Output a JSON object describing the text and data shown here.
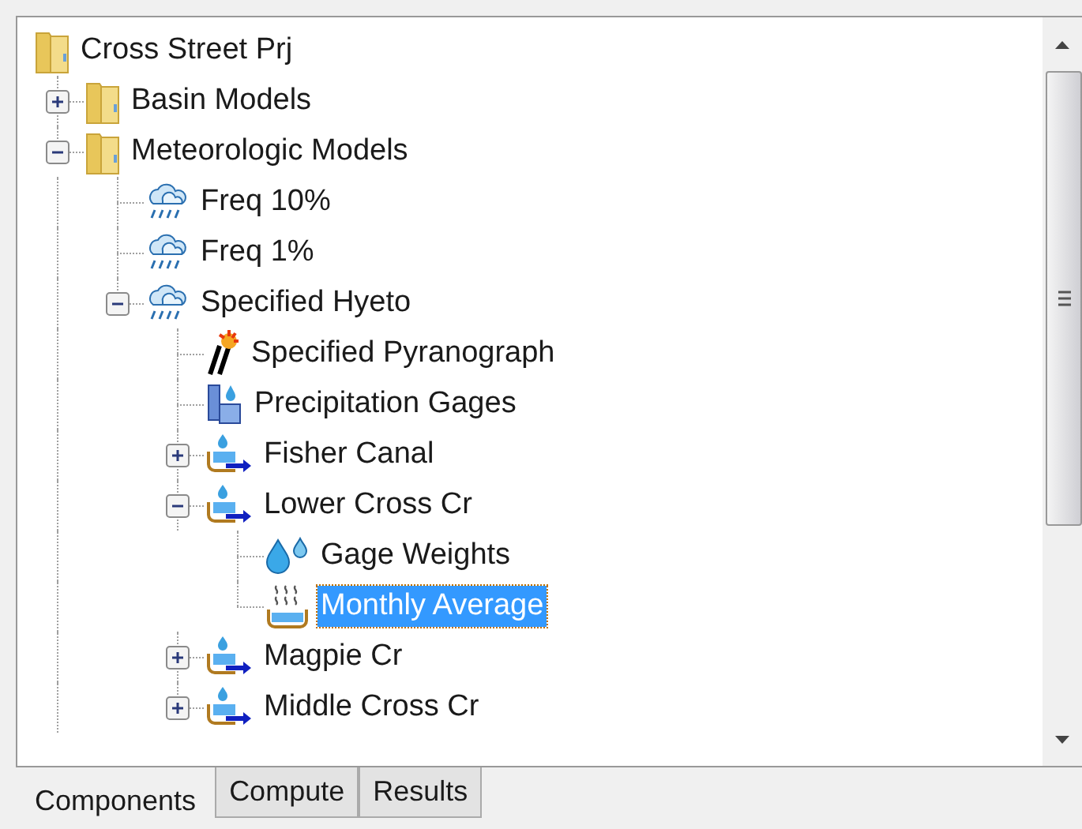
{
  "tree": {
    "label": "Cross Street Prj",
    "kind": "folder",
    "children": [
      {
        "label": "Basin Models",
        "kind": "folder",
        "expanded": false,
        "selected": false
      },
      {
        "label": "Meteorologic Models",
        "kind": "folder",
        "expanded": true,
        "selected": false,
        "children": [
          {
            "label": "Freq 10%",
            "kind": "meteo",
            "selected": false
          },
          {
            "label": "Freq 1%",
            "kind": "meteo",
            "selected": false
          },
          {
            "label": "Specified Hyeto",
            "kind": "meteo",
            "expanded": true,
            "selected": false,
            "children": [
              {
                "label": "Specified Pyranograph",
                "kind": "pyranograph",
                "selected": false
              },
              {
                "label": "Precipitation Gages",
                "kind": "gages",
                "selected": false
              },
              {
                "label": "Fisher Canal",
                "kind": "subbasin",
                "expanded": false,
                "selected": false
              },
              {
                "label": "Lower Cross Cr",
                "kind": "subbasin",
                "expanded": true,
                "selected": false,
                "children": [
                  {
                    "label": "Gage Weights",
                    "kind": "weights",
                    "selected": false
                  },
                  {
                    "label": "Monthly Average",
                    "kind": "monthly",
                    "selected": true
                  }
                ]
              },
              {
                "label": "Magpie Cr",
                "kind": "subbasin",
                "expanded": false,
                "selected": false
              },
              {
                "label": "Middle Cross Cr",
                "kind": "subbasin",
                "expanded": false,
                "selected": false
              }
            ]
          }
        ]
      }
    ]
  },
  "tabs": [
    {
      "label": "Components",
      "selected": true
    },
    {
      "label": "Compute",
      "selected": false
    },
    {
      "label": "Results",
      "selected": false
    }
  ]
}
